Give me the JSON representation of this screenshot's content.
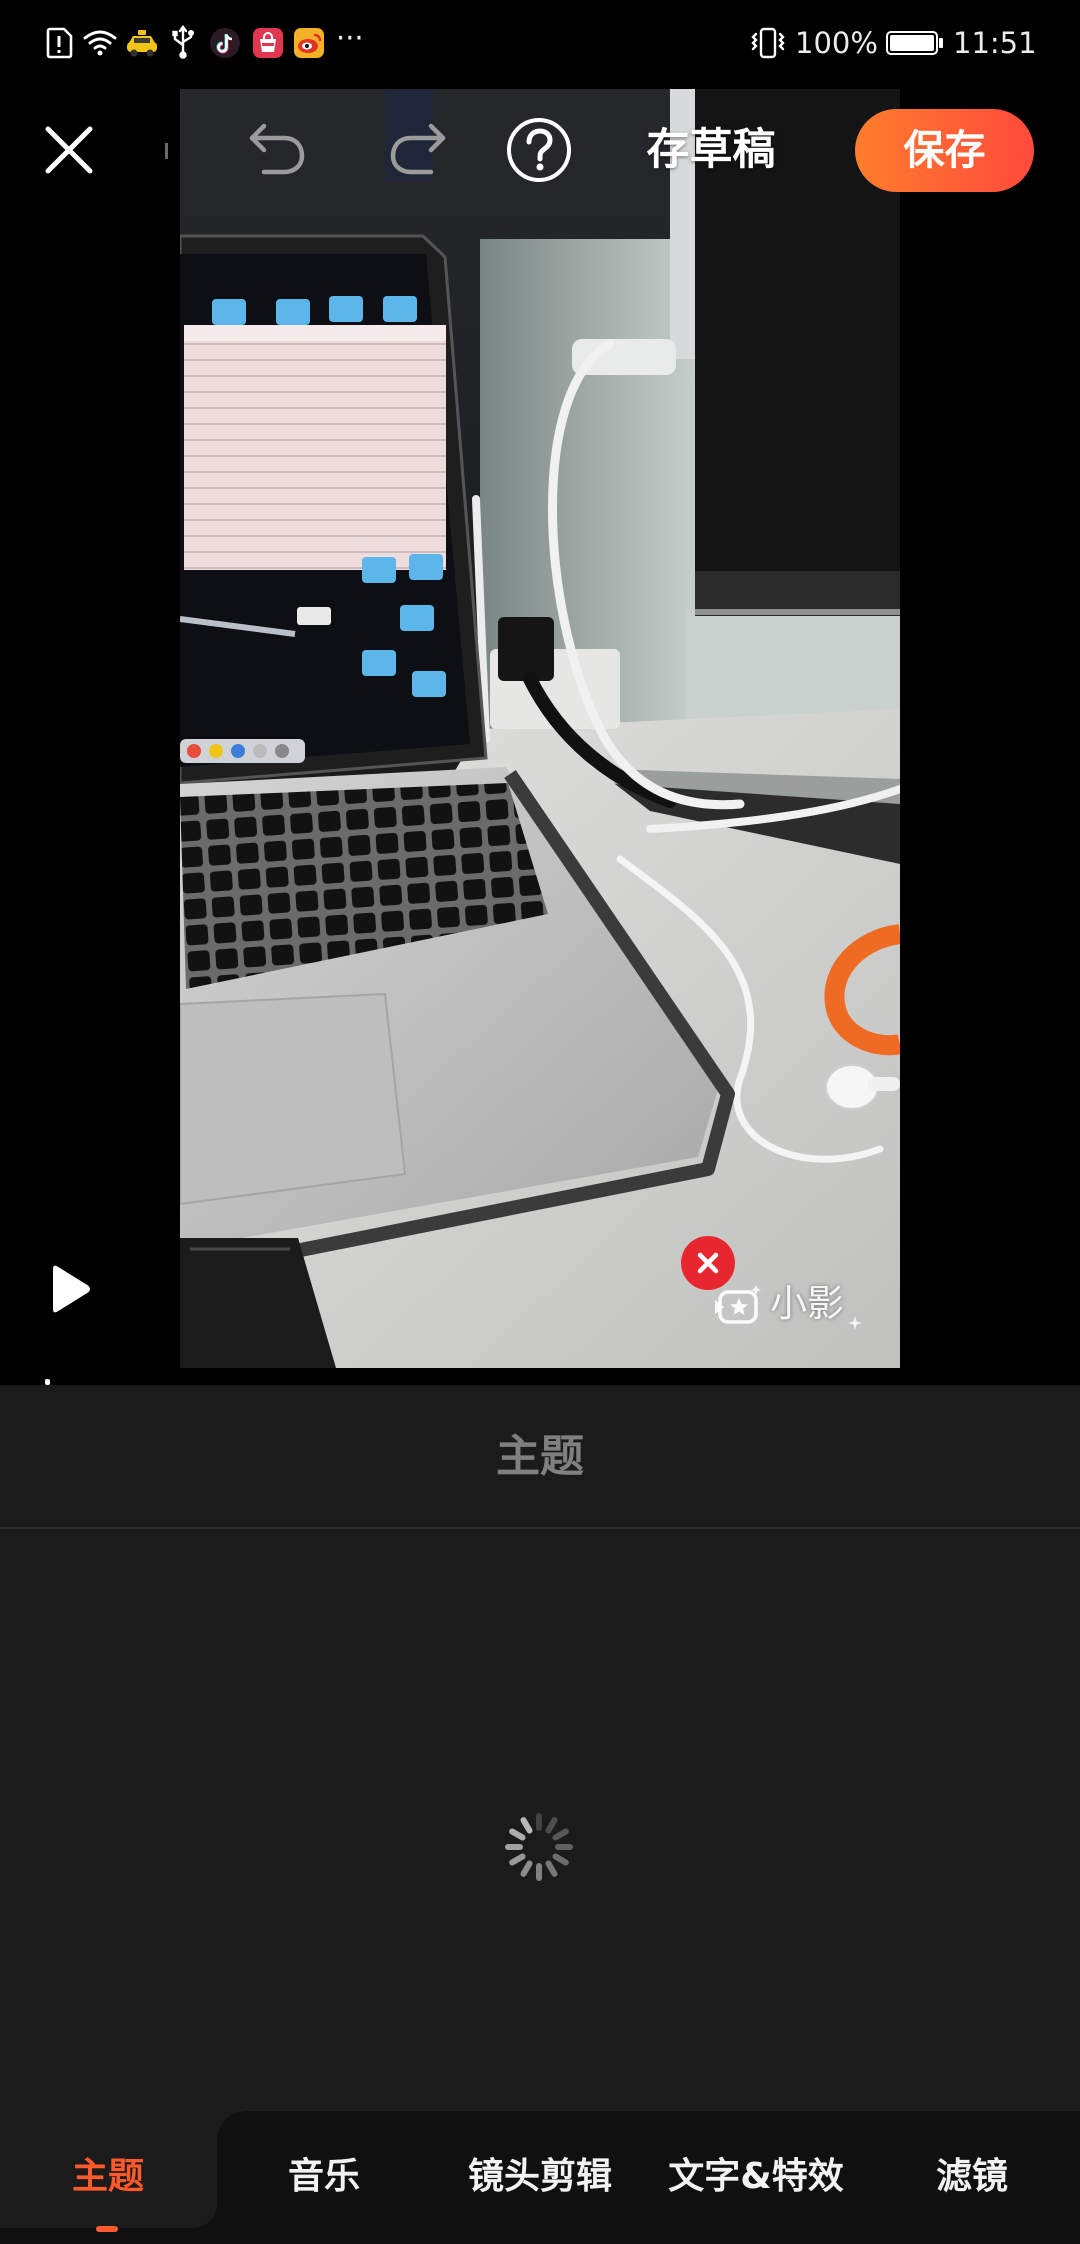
{
  "status_bar": {
    "left_icons": [
      "alert-icon",
      "wifi-icon",
      "taxi-icon",
      "usb-icon",
      "tiktok-icon",
      "shopping-icon",
      "weibo-icon"
    ],
    "more": "···",
    "right_icons": [
      "vibrate-icon",
      "battery-icon"
    ],
    "battery": "100%",
    "time": "11:51"
  },
  "toolbar": {
    "icons": {
      "close": "close-icon",
      "undo": "undo-icon",
      "redo": "redo-icon",
      "help": "help-icon"
    },
    "draft_label": "存草稿",
    "save_label": "保存"
  },
  "preview": {
    "play_icon": "play-icon",
    "watermark_icon": "xiaoying-logo-icon",
    "watermark_text": "小影",
    "remove_watermark_icon": "close-icon"
  },
  "panel": {
    "title": "主题",
    "loading_icon": "spinner-icon"
  },
  "tabs": {
    "active_index": 0,
    "items": [
      {
        "label": "主题"
      },
      {
        "label": "音乐"
      },
      {
        "label": "镜头剪辑"
      },
      {
        "label": "文字&特效"
      },
      {
        "label": "滤镜"
      }
    ]
  },
  "colors": {
    "accent": "#ff5a2c",
    "save_gradient_start": "#ff7d2c",
    "save_gradient_end": "#ff4a3c",
    "remove_watermark": "#e8262e",
    "panel_bg": "#1b1b1b",
    "tab_bar_bg": "#101010",
    "panel_title": "#808080",
    "disabled_icon": "#9b9b9b"
  }
}
